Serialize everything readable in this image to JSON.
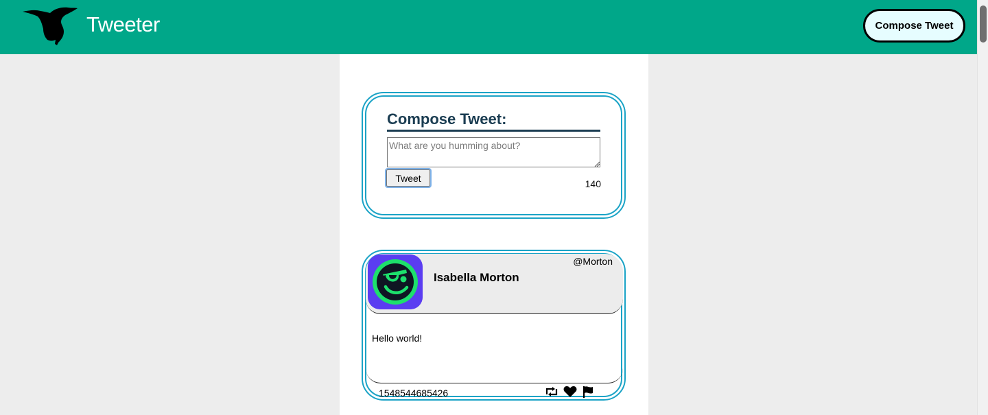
{
  "header": {
    "brand": "Tweeter",
    "compose_button": "Compose Tweet",
    "colors": {
      "bar": "#00a789",
      "button_bg": "#e6fdff"
    }
  },
  "compose": {
    "title": "Compose Tweet:",
    "placeholder": "What are you humming about?",
    "submit_label": "Tweet",
    "char_count": "140"
  },
  "tweets": [
    {
      "name": "Isabella Morton",
      "handle": "@Morton",
      "text": "Hello world!",
      "timestamp": "1548544685426",
      "avatar_icon": "pirate-smiley-icon",
      "actions": [
        "retweet-icon",
        "heart-icon",
        "flag-icon"
      ]
    }
  ],
  "theme": {
    "card_border": "#1aa3c6",
    "heading": "#1b3d52"
  }
}
